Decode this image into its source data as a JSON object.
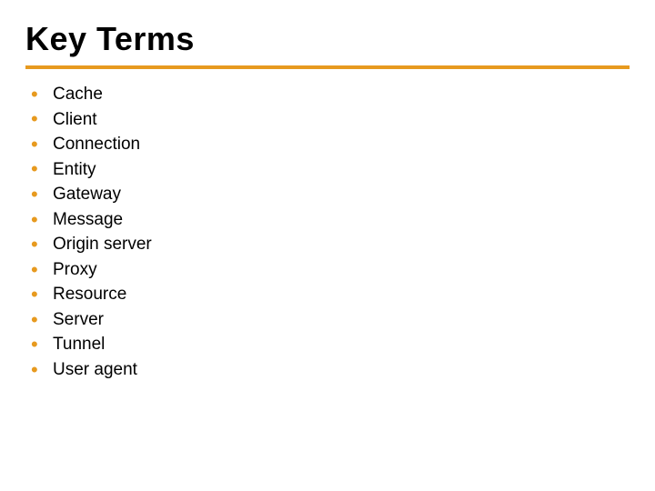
{
  "colors": {
    "accent": "#e79a1f"
  },
  "slide": {
    "title": "Key Terms",
    "bullet_glyph": "•",
    "items": [
      {
        "label": "Cache"
      },
      {
        "label": "Client"
      },
      {
        "label": "Connection"
      },
      {
        "label": "Entity"
      },
      {
        "label": "Gateway"
      },
      {
        "label": "Message"
      },
      {
        "label": "Origin server"
      },
      {
        "label": "Proxy"
      },
      {
        "label": "Resource"
      },
      {
        "label": "Server"
      },
      {
        "label": "Tunnel"
      },
      {
        "label": "User agent"
      }
    ]
  }
}
